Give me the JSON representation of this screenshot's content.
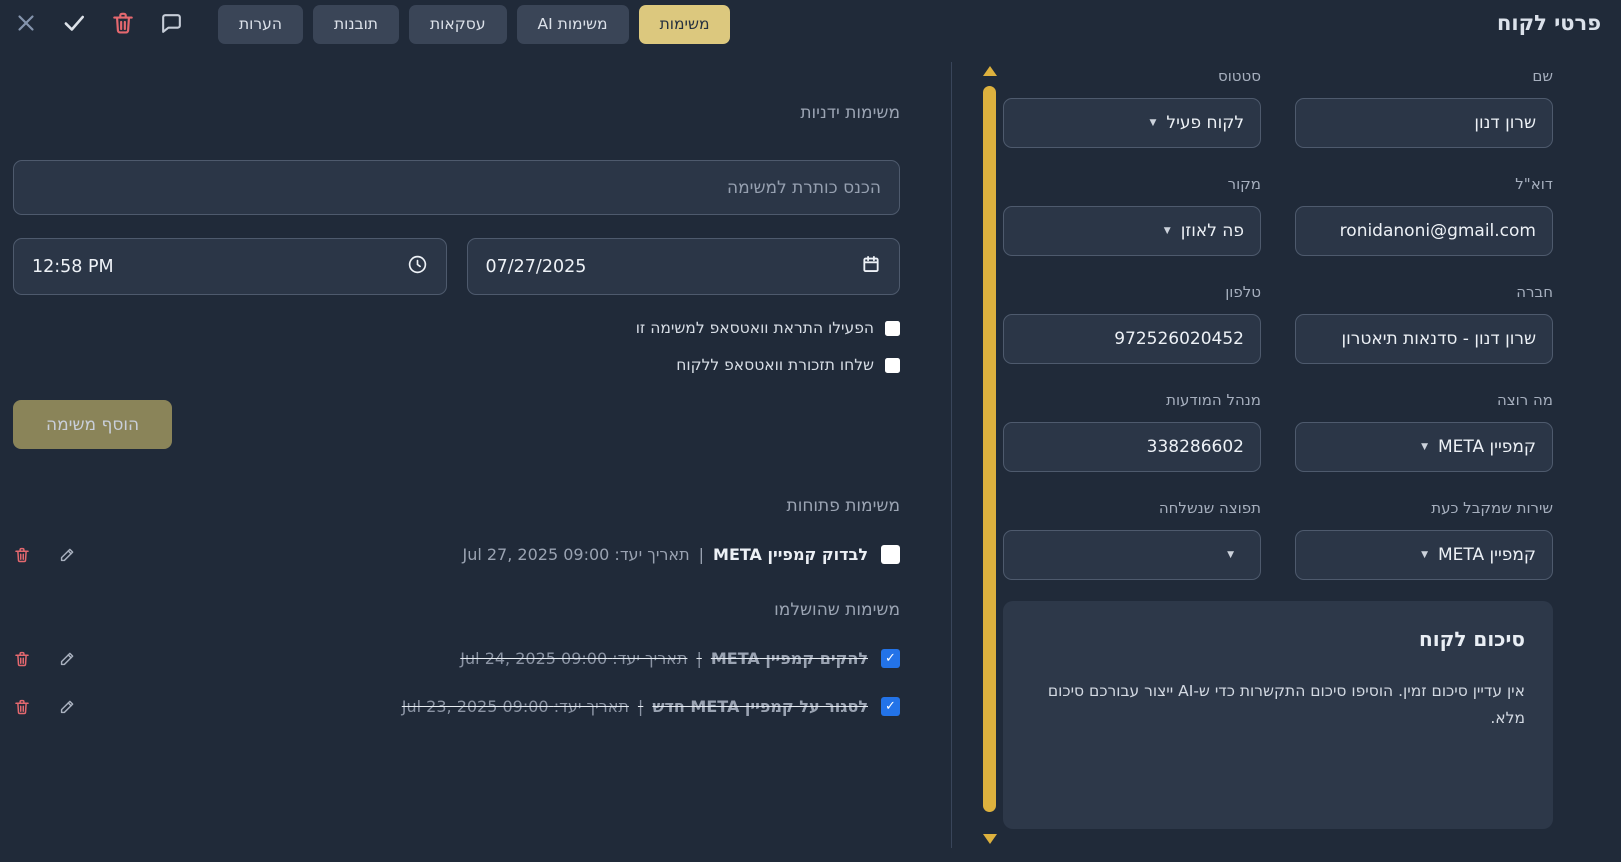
{
  "header": {
    "title": "פרטי לקוח",
    "tabs": [
      {
        "label": "משימות",
        "active": true
      },
      {
        "label": "משימות AI",
        "active": false
      },
      {
        "label": "עסקאות",
        "active": false
      },
      {
        "label": "תובנות",
        "active": false
      },
      {
        "label": "הערות",
        "active": false
      }
    ],
    "icons": [
      "close-icon",
      "confirm-icon",
      "trash-icon",
      "comment-icon"
    ]
  },
  "details": {
    "fields": [
      {
        "label": "שם",
        "value": "שרון דנון",
        "type": "input"
      },
      {
        "label": "סטטוס",
        "value": "לקוח פעיל",
        "type": "select"
      },
      {
        "label": "דוא\"ל",
        "value": "ronidanoni@gmail.com",
        "type": "input"
      },
      {
        "label": "מקור",
        "value": "פה לאוזן",
        "type": "select"
      },
      {
        "label": "חברה",
        "value": "שרון דנון - סדנאות תיאטרון",
        "type": "input"
      },
      {
        "label": "טלפון",
        "value": "972526020452",
        "type": "input"
      },
      {
        "label": "מה רוצה",
        "value": "קמפיין META",
        "type": "select"
      },
      {
        "label": "מנהל המודעות",
        "value": "338286602",
        "type": "input"
      },
      {
        "label": "שירות שמקבל כעת",
        "value": "קמפיין META",
        "type": "select"
      },
      {
        "label": "תפוצה שנשלחה",
        "value": "",
        "type": "select"
      }
    ],
    "summary": {
      "title": "סיכום לקוח",
      "text": "אין עדיין סיכום זמין. הוסיפו סיכום התקשרות כדי ש-AI ייצור עבורכם סיכום מלא."
    }
  },
  "tasks": {
    "manual_heading": "משימות ידניות",
    "title_placeholder": "הכנס כותרת למשימה",
    "time_value": "12:58 PM",
    "date_value": "07/27/2025",
    "checkbox_whatsapp_alert": "הפעילו התראת וואטסאפ למשימה זו",
    "checkbox_whatsapp_reminder": "שלחו תזכורת וואטסאפ ללקוח",
    "add_button": "הוסף משימה",
    "open_heading": "משימות פתוחות",
    "due_label": "תאריך יעד:",
    "separator": "|",
    "open_tasks": [
      {
        "name": "לבדוק קמפיין META",
        "due": "Jul 27, 2025 09:00",
        "done": false
      }
    ],
    "completed_heading": "משימות שהושלמו",
    "completed_tasks": [
      {
        "name": "להקים קמפיין META",
        "due": "Jul 24, 2025 09:00",
        "done": true
      },
      {
        "name": "לסגור על קמפיין META חדש",
        "due": "Jul 23, 2025 09:00",
        "done": true
      }
    ]
  },
  "colors": {
    "active_tab_yellow": "#dcc87e",
    "scrollbar_yellow": "#ddb13e",
    "danger_red": "#e4686f",
    "checked_blue": "#2373e8",
    "add_button_olive": "#8a8459",
    "background": "#202a39",
    "input_background": "#2b3647"
  }
}
